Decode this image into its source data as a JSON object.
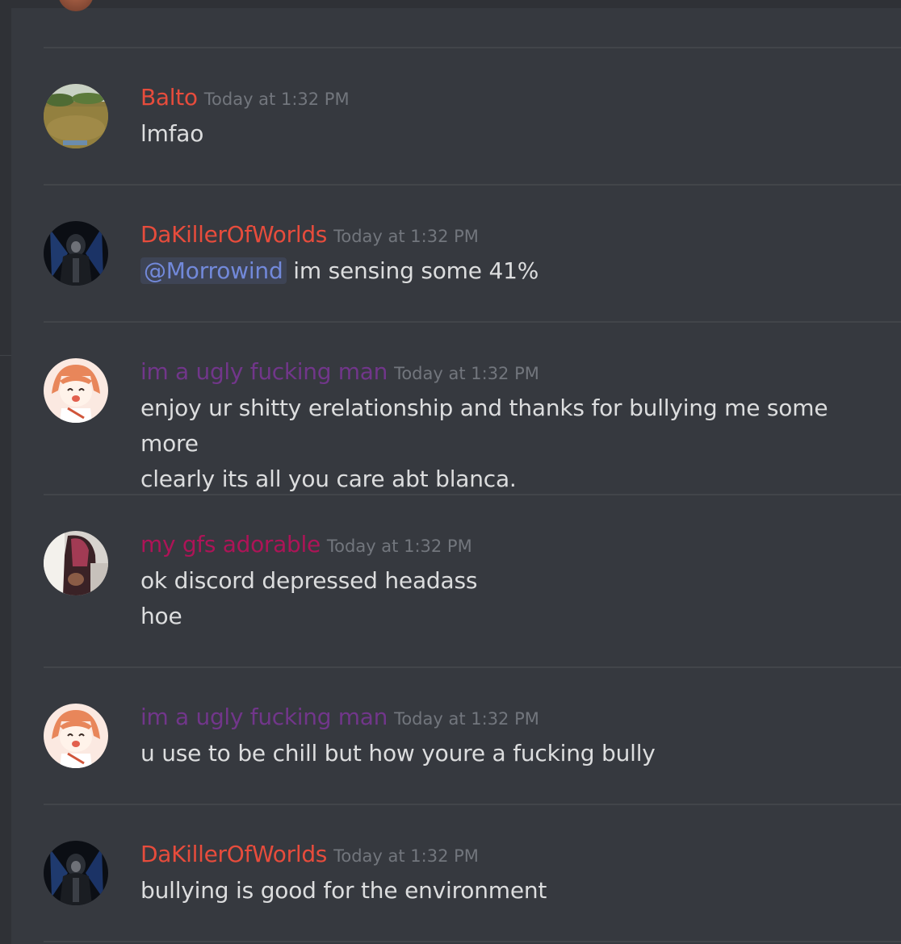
{
  "colors": {
    "background": "#36393f",
    "text": "#dcddde",
    "timestamp": "#72767d",
    "mention": "#7289da",
    "divider": "#42454a"
  },
  "messages": [
    {
      "username": "Balto",
      "username_color": "#e74c3c",
      "timestamp": "Today at 1:32 PM",
      "avatar": "field-photo",
      "lines": [
        "lmfao"
      ]
    },
    {
      "username": "DaKillerOfWorlds",
      "username_color": "#e74c3c",
      "timestamp": "Today at 1:32 PM",
      "avatar": "dark-reaper",
      "mention": "@Morrowind",
      "lines": [
        "im sensing some 41%"
      ]
    },
    {
      "username": "im a ugly fucking man",
      "username_color": "#71368a",
      "timestamp": "Today at 1:32 PM",
      "avatar": "anime-girl",
      "lines": [
        "enjoy ur shitty erelationship and thanks for bullying me some more",
        "clearly its all you care abt blanca."
      ]
    },
    {
      "username": "my gfs adorable",
      "username_color": "#ad1457",
      "timestamp": "Today at 1:32 PM",
      "avatar": "person-photo",
      "lines": [
        "ok discord depressed headass",
        "hoe"
      ]
    },
    {
      "username": "im a ugly fucking man",
      "username_color": "#71368a",
      "timestamp": "Today at 1:32 PM",
      "avatar": "anime-girl",
      "lines": [
        "u use to be chill but how youre a fucking bully"
      ]
    },
    {
      "username": "DaKillerOfWorlds",
      "username_color": "#e74c3c",
      "timestamp": "Today at 1:32 PM",
      "avatar": "dark-reaper",
      "lines": [
        "bullying is good for the environment"
      ]
    }
  ]
}
